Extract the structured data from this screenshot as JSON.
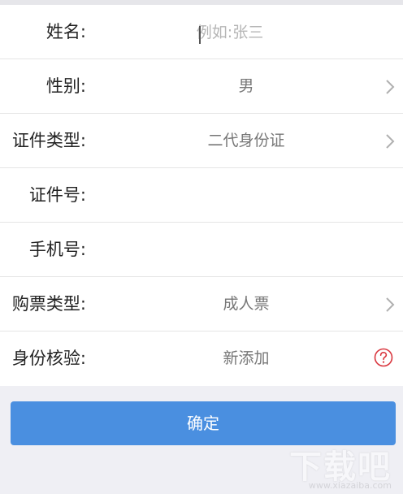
{
  "form": {
    "name": {
      "label": "姓名:",
      "placeholder": "例如:张三"
    },
    "gender": {
      "label": "性别:",
      "value": "男"
    },
    "id_type": {
      "label": "证件类型:",
      "value": "二代身份证"
    },
    "id_number": {
      "label": "证件号:",
      "value": ""
    },
    "phone": {
      "label": "手机号:",
      "value": ""
    },
    "ticket_type": {
      "label": "购票类型:",
      "value": "成人票"
    },
    "verify": {
      "label": "身份核验:",
      "value": "新添加"
    }
  },
  "confirm_label": "确定",
  "watermark": {
    "text": "下载吧",
    "url": "www.xiazaiba.com"
  },
  "icons": {
    "chevron": "chevron-right-icon",
    "help": "question-circle-icon"
  },
  "colors": {
    "primary": "#4a8fe0",
    "help": "#d9363e",
    "background": "#efeff4"
  }
}
